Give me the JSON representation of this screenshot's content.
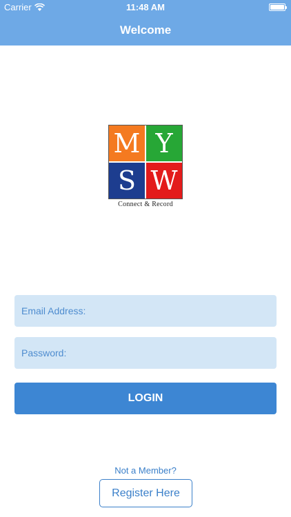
{
  "status_bar": {
    "carrier": "Carrier",
    "time": "11:48 AM",
    "icons": [
      "wifi-icon",
      "battery-icon"
    ]
  },
  "nav": {
    "title": "Welcome"
  },
  "logo": {
    "letters": [
      "M",
      "Y",
      "S",
      "W"
    ],
    "tagline": "Connect & Record",
    "colors": [
      "#f47a20",
      "#27a736",
      "#1d3d8f",
      "#e31b1b"
    ]
  },
  "form": {
    "email_placeholder": "Email Address:",
    "email_value": "",
    "password_placeholder": "Password:",
    "password_value": "",
    "login_label": "LOGIN"
  },
  "footer": {
    "not_member": "Not a Member?",
    "register_label": "Register Here"
  },
  "colors": {
    "nav_bg": "#6ea9e6",
    "field_bg": "#d3e6f6",
    "button_bg": "#3d86d3",
    "link": "#3a7fc9"
  }
}
